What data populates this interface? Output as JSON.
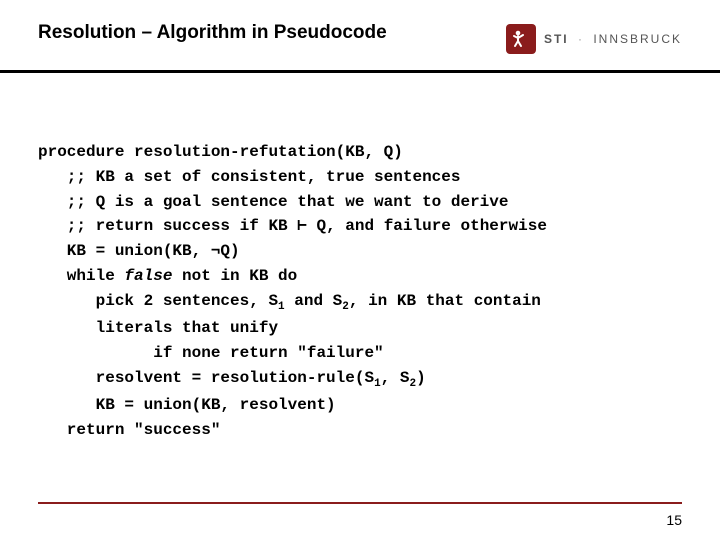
{
  "header": {
    "title": "Resolution – Algorithm in Pseudocode",
    "logo_brand": "STI",
    "logo_sep": "·",
    "logo_sub": "INNSBRUCK"
  },
  "code": {
    "l1": "procedure resolution-refutation(KB, Q)",
    "l2": "   ;; KB a set of consistent, true sentences",
    "l3": "   ;; Q is a goal sentence that we want to derive",
    "l4": "   ;; return success if KB ⊢ Q, and failure otherwise",
    "l5": "   KB = union(KB, ¬Q)",
    "l6a": "   while ",
    "l6b": "false",
    "l6c": " not in KB do",
    "l7a": "      pick 2 sentences, S",
    "l7s1": "1",
    "l7b": " and S",
    "l7s2": "2",
    "l7c": ", in KB that contain",
    "l8": "      literals that unify",
    "l9": "            if none return \"failure\"",
    "l10a": "      resolvent = resolution-rule(S",
    "l10s1": "1",
    "l10b": ", S",
    "l10s2": "2",
    "l10c": ")",
    "l11": "      KB = union(KB, resolvent)",
    "l12": "   return \"success\""
  },
  "footer": {
    "page": "15"
  }
}
